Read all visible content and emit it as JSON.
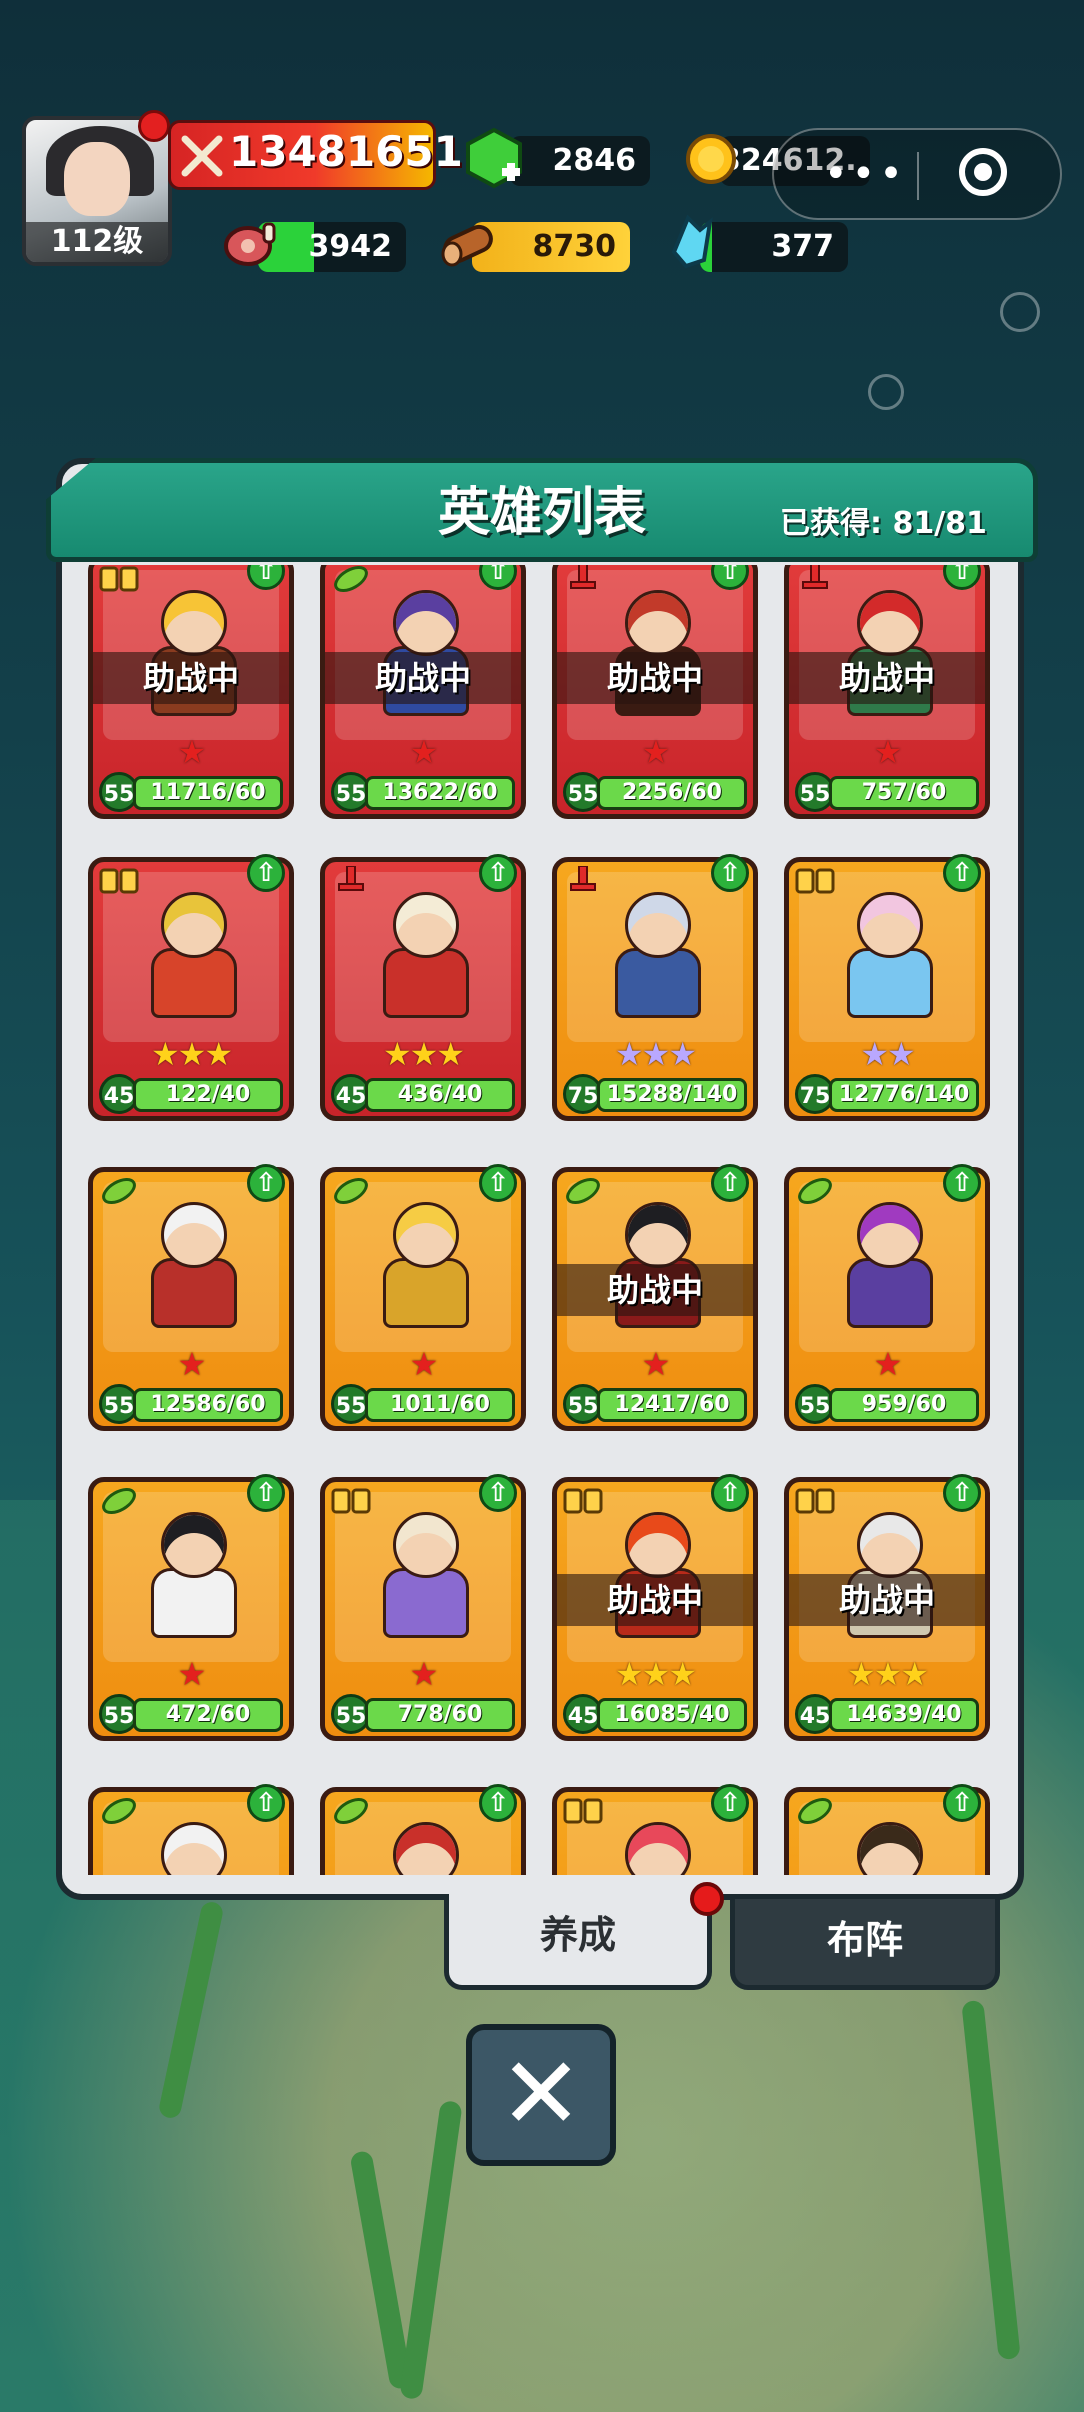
{
  "player": {
    "level_label": "112级",
    "power": "13481651"
  },
  "resources": {
    "gems": "2846",
    "gold": "324612.",
    "meat": "3942",
    "wood": "8730",
    "crystal": "377"
  },
  "panel": {
    "title": "英雄列表",
    "obtained": "已获得: 81/81"
  },
  "cards": [
    {
      "color": "red",
      "badge": "book",
      "assist": "助战中",
      "stars": 1,
      "star_color": "red",
      "level": "55",
      "progress": "11716/60",
      "hero_hair": "#f7c436",
      "hero_cloth": "#8a3b1f"
    },
    {
      "color": "red",
      "badge": "leaf",
      "assist": "助战中",
      "stars": 1,
      "star_color": "red",
      "level": "55",
      "progress": "13622/60",
      "hero_hair": "#5a3fa0",
      "hero_cloth": "#2f4aa0"
    },
    {
      "color": "red",
      "badge": "sword",
      "assist": "助战中",
      "stars": 1,
      "star_color": "red",
      "level": "55",
      "progress": "2256/60",
      "hero_hair": "#c23a2a",
      "hero_cloth": "#3a1b12"
    },
    {
      "color": "red",
      "badge": "sword",
      "assist": "助战中",
      "stars": 1,
      "star_color": "red",
      "level": "55",
      "progress": "757/60",
      "hero_hair": "#d32a2a",
      "hero_cloth": "#2f7a4a"
    },
    {
      "color": "red",
      "badge": "book",
      "assist": "",
      "stars": 3,
      "star_color": "gold",
      "level": "45",
      "progress": "122/40",
      "hero_hair": "#e8c43a",
      "hero_cloth": "#d7442a"
    },
    {
      "color": "red",
      "badge": "sword",
      "assist": "",
      "stars": 3,
      "star_color": "gold",
      "level": "45",
      "progress": "436/40",
      "hero_hair": "#f4ecd6",
      "hero_cloth": "#c9302a"
    },
    {
      "color": "orange",
      "badge": "sword",
      "assist": "",
      "stars": 3,
      "star_color": "purple",
      "level": "75",
      "progress": "15288/140",
      "hero_hair": "#cfd8e8",
      "hero_cloth": "#3a5aa0"
    },
    {
      "color": "orange",
      "badge": "book",
      "assist": "",
      "stars": 2,
      "star_color": "purple",
      "level": "75",
      "progress": "12776/140",
      "hero_hair": "#f2c6e0",
      "hero_cloth": "#7ac6f0"
    },
    {
      "color": "orange",
      "badge": "leaf",
      "assist": "",
      "stars": 1,
      "star_color": "red",
      "level": "55",
      "progress": "12586/60",
      "hero_hair": "#f2f2f2",
      "hero_cloth": "#b8302a"
    },
    {
      "color": "orange",
      "badge": "leaf",
      "assist": "",
      "stars": 1,
      "star_color": "red",
      "level": "55",
      "progress": "1011/60",
      "hero_hair": "#f6cc44",
      "hero_cloth": "#d9a42a"
    },
    {
      "color": "orange",
      "badge": "leaf",
      "assist": "助战中",
      "stars": 1,
      "star_color": "red",
      "level": "55",
      "progress": "12417/60",
      "hero_hair": "#1e1e22",
      "hero_cloth": "#8a1a1a"
    },
    {
      "color": "orange",
      "badge": "leaf",
      "assist": "",
      "stars": 1,
      "star_color": "red",
      "level": "55",
      "progress": "959/60",
      "hero_hair": "#a03ac0",
      "hero_cloth": "#5a3fa0"
    },
    {
      "color": "orange",
      "badge": "leaf",
      "assist": "",
      "stars": 1,
      "star_color": "red",
      "level": "55",
      "progress": "472/60",
      "hero_hair": "#1e1e22",
      "hero_cloth": "#f2f2f2"
    },
    {
      "color": "orange",
      "badge": "book",
      "assist": "",
      "stars": 1,
      "star_color": "red",
      "level": "55",
      "progress": "778/60",
      "hero_hair": "#f2e6cf",
      "hero_cloth": "#8a6ad0"
    },
    {
      "color": "orange",
      "badge": "book",
      "assist": "助战中",
      "stars": 3,
      "star_color": "gold",
      "level": "45",
      "progress": "16085/40",
      "hero_hair": "#e84a1a",
      "hero_cloth": "#b82a1a"
    },
    {
      "color": "orange",
      "badge": "book",
      "assist": "助战中",
      "stars": 3,
      "star_color": "gold",
      "level": "45",
      "progress": "14639/40",
      "hero_hair": "#e8e8e8",
      "hero_cloth": "#cfc8b0"
    },
    {
      "color": "orange",
      "badge": "leaf",
      "assist": "",
      "stars": 0,
      "star_color": "red",
      "level": "",
      "progress": "",
      "hero_hair": "#f2f2f2",
      "hero_cloth": "#d9a42a"
    },
    {
      "color": "orange",
      "badge": "leaf",
      "assist": "",
      "stars": 0,
      "star_color": "red",
      "level": "",
      "progress": "",
      "hero_hair": "#c9302a",
      "hero_cloth": "#d9a42a"
    },
    {
      "color": "orange",
      "badge": "book",
      "assist": "",
      "stars": 0,
      "star_color": "red",
      "level": "",
      "progress": "",
      "hero_hair": "#e8485a",
      "hero_cloth": "#d9a42a"
    },
    {
      "color": "orange",
      "badge": "leaf",
      "assist": "",
      "stars": 0,
      "star_color": "red",
      "level": "",
      "progress": "",
      "hero_hair": "#3a2a1a",
      "hero_cloth": "#d9a42a"
    }
  ],
  "tabs": {
    "develop": "养成",
    "formation": "布阵"
  },
  "close_label": "✕",
  "capsule": {
    "more": "•••"
  }
}
